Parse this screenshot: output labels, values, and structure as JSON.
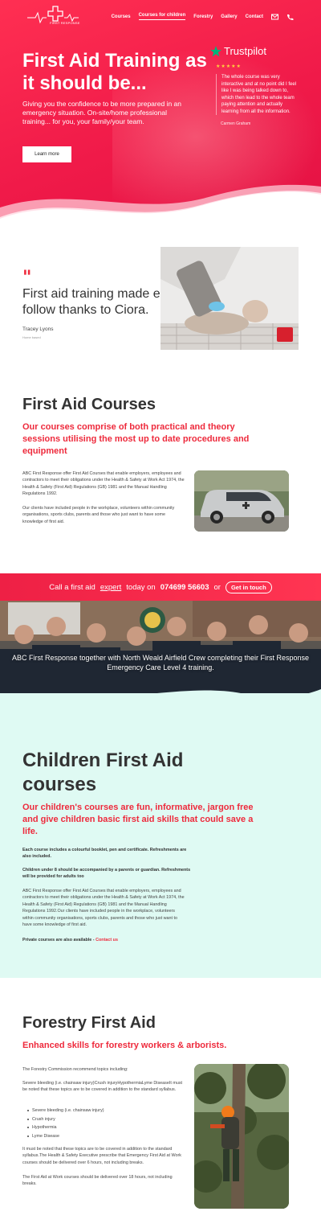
{
  "header": {
    "logo_text": "ABC",
    "logo_sub": "FIRST RESPONSE",
    "nav": [
      {
        "label": "Courses",
        "active": false
      },
      {
        "label": "Courses for children",
        "active": true
      },
      {
        "label": "Forestry",
        "active": false
      },
      {
        "label": "Gallery",
        "active": false
      },
      {
        "label": "Contact",
        "active": false
      }
    ],
    "icons": [
      "mail-icon",
      "phone-icon"
    ]
  },
  "hero": {
    "title": "First Aid Training as it should be...",
    "lede": "Giving you the confidence to be more prepared in an emergency situation. On-site/home professional training... for you, your family/your team.",
    "button": "Learn more",
    "brand_color": "#f01a49"
  },
  "trustpilot": {
    "brand": "Trustpilot",
    "stars": "★★★★★",
    "rating": 5,
    "quote": "The whole course was very interactive and at no point did I feel like I was being talked down to, which then lead to the whole team paying attention and actually learning from all the information.",
    "author": "Carmen Graham"
  },
  "testimonial": {
    "mark": "\"",
    "text": "First aid training made easy to follow thanks to Ciora.",
    "name": "Tracey Lyons",
    "location": "Home based"
  },
  "courses": {
    "title": "First Aid Courses",
    "subtitle": "Our courses comprise of both practical and theory sessions utilising the most up to date procedures and equipment",
    "p1": "ABC First Response offer First Aid Courses that enable employers, employees and contractors to meet their obligations under the Health & Safety at Work Act 1974, the Health & Safety (First Aid) Regulations (GB) 1981 and the Manual Handling Regulations 1992.",
    "p2": "Our clients have included people in the workplace, volunteers within community organisations, sports clubs, parents and those who just want to have some knowledge of first aid."
  },
  "cta": {
    "before": "Call a first aid",
    "expert": "expert",
    "middle": "today on",
    "phone": "074699 56603",
    "or": "or",
    "button": "Get in touch"
  },
  "team": {
    "caption": "ABC First Response together with North Weald Airfield Crew completing their First Response Emergency Care Level 4 training."
  },
  "children": {
    "title": "Children First Aid courses",
    "subtitle": "Our children's courses are fun, informative, jargon free and give children basic first aid skills that could save a life.",
    "b1": "Each course includes a colourful booklet, pen and certificate. Refreshments are also included.",
    "b2": "Children under 8 should be accompanied by a parents or guardian. Refreshments will be provided for adults too",
    "p": "ABC First Response offer First Aid Courses that enable employers, employees and contractors to meet their obligations under the Health & Safety at Work Act 1974, the Health & Safety (First Aid) Regulations (GB) 1981 and the Manual Handling Regulations 1992.Our clients have included people in the workplace, volunteers within community organisations, sports clubs, parents and those who just want to have some knowledge of first aid.",
    "private": "Private courses are also available -",
    "contact": "Contact us"
  },
  "forestry": {
    "title": "Forestry First Aid",
    "subtitle": "Enhanced skills for forestry workers & arborists.",
    "p1": "The Forestry Commission recommend topics including:",
    "p2": "Severe bleeding (i.e. chainsaw injury)Crush injuryHypothermiaLyme DiseaseIt must be noted that these topics are to be covered in addition to the standard syllabus.",
    "list": [
      "Severe bleeding (i.e. chainsaw injury)",
      "Crush injury",
      "Hypothermia",
      "Lyme Disease"
    ],
    "p3": "It must be noted that these topics are to be covered in addition to the standard syllabus.The Health & Safety Executive prescribe that Emergency First Aid at Work courses should be delivered over 6 hours, not including breaks.",
    "p4": "The First Aid at Work courses should be delivered over 18 hours, not including breaks."
  }
}
